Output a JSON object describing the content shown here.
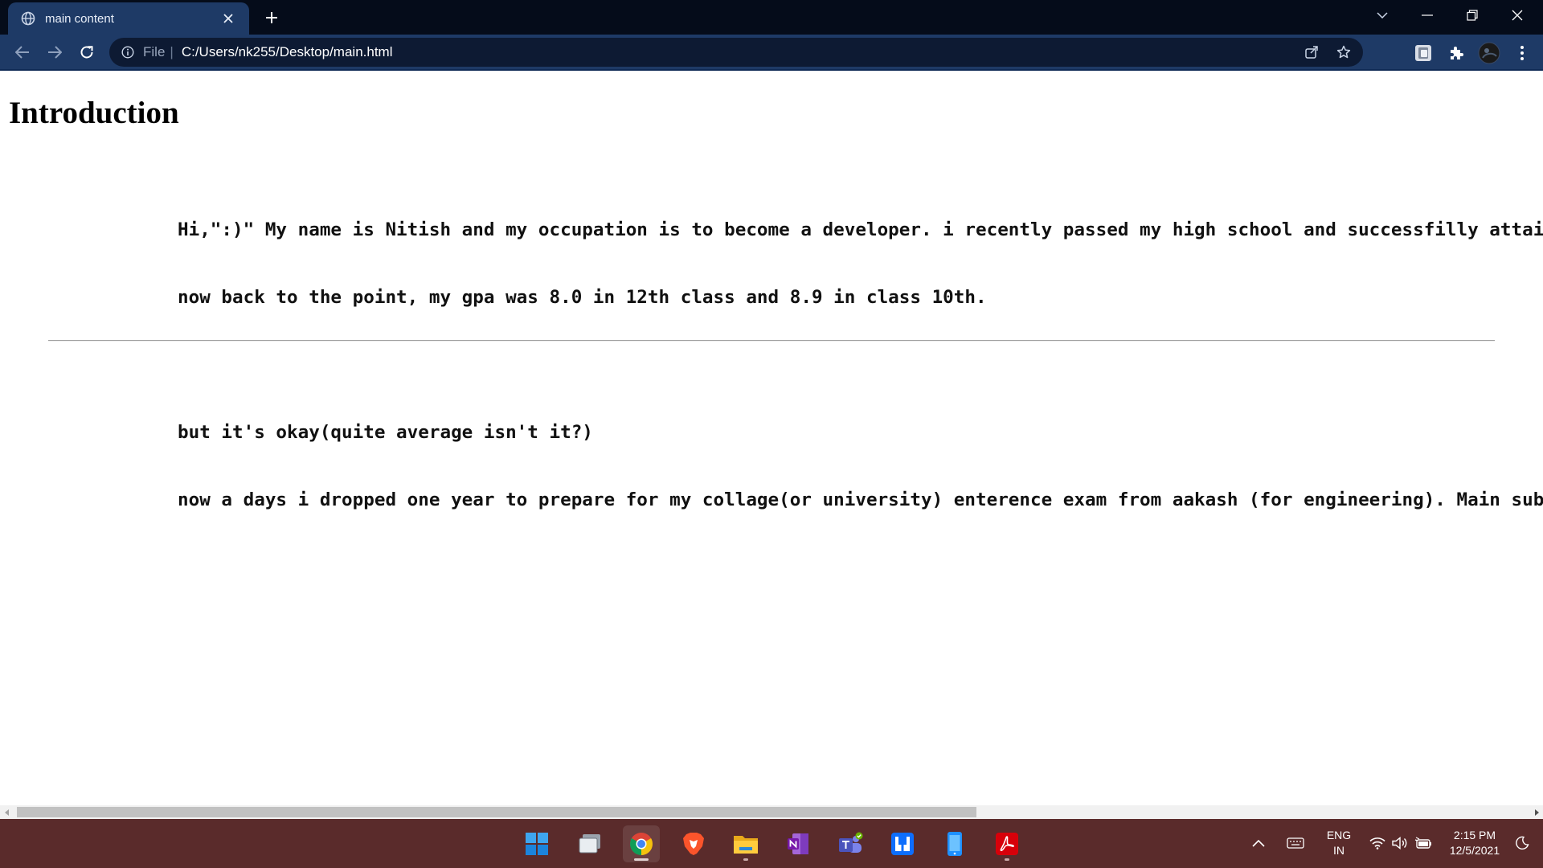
{
  "browser": {
    "tab_title": "main content",
    "omnibox": {
      "scheme_label": "File",
      "separator": "|",
      "url": "C:/Users/nk255/Desktop/main.html"
    }
  },
  "page": {
    "heading": "Introduction",
    "paragraph_lines": [
      "Hi,\":)\" My name is Nitish and my occupation is to become a developer. i recently passed my high school and successfilly attain",
      "now back to the point, my gpa was 8.0 in 12th class and 8.9 in class 10th.",
      "",
      "but it's okay(quite average isn't it?)",
      "now a days i dropped one year to prepare for my collage(or university) enterence exam from aakash (for engineering). Main subja"
    ]
  },
  "taskbar": {
    "apps": [
      "start-icon",
      "task-view-icon",
      "chrome-icon",
      "brave-icon",
      "file-explorer-icon",
      "onenote-icon",
      "teams-icon",
      "app-icon",
      "phone-link-icon",
      "acrobat-icon"
    ],
    "language": {
      "line1": "ENG",
      "line2": "IN"
    },
    "clock": {
      "time": "2:15 PM",
      "date": "12/5/2021"
    }
  },
  "colors": {
    "titlebar": "#050c1a",
    "toolbar": "#1e3a66",
    "omnibox": "#0d1a33",
    "taskbar": "#5a2b2b"
  }
}
